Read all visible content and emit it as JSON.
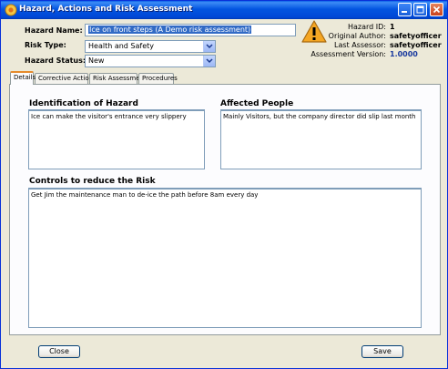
{
  "window": {
    "title": "Hazard, Actions and Risk Assessment",
    "buttons": [
      "minimize",
      "maximize",
      "close"
    ]
  },
  "form": {
    "hazard_name_label": "Hazard Name:",
    "hazard_name_value": "Ice on front steps (A Demo risk assessment)",
    "risk_type_label": "Risk Type:",
    "risk_type_value": "Health and Safety",
    "hazard_status_label": "Hazard Status:",
    "hazard_status_value": "New"
  },
  "info": {
    "hazard_id_label": "Hazard ID:",
    "hazard_id_value": "1",
    "original_author_label": "Original Author:",
    "original_author_value": "safetyofficer",
    "last_assessor_label": "Last Assessor:",
    "last_assessor_value": "safetyofficer",
    "assessment_version_label": "Assessment Version:",
    "assessment_version_value": "1.0000",
    "version_color": "#1a3a9e",
    "warning_icon": "warning-triangle-icon"
  },
  "tabs": [
    {
      "label": "Details",
      "active": true
    },
    {
      "label": "Corrective Actions",
      "active": false
    },
    {
      "label": "Risk Assessment",
      "active": false
    },
    {
      "label": "Procedures",
      "active": false
    }
  ],
  "details": {
    "identification_label": "Identification of Hazard",
    "identification_value": "Ice can make the visitor's entrance very slippery",
    "affected_label": "Affected People",
    "affected_value": "Mainly Visitors, but the company director did slip last month",
    "controls_label": "Controls to reduce the Risk",
    "controls_value": "Get Jim the maintenance man to de-ice the path before 8am every day"
  },
  "footer": {
    "close_label": "Close",
    "save_label": "Save"
  }
}
